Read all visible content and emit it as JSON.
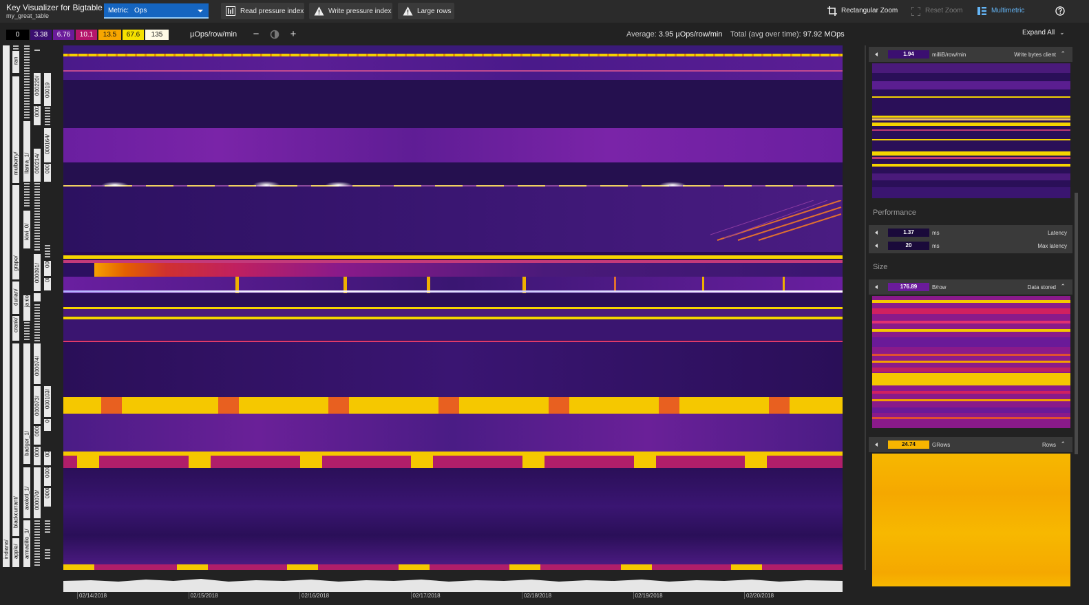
{
  "app": {
    "title": "Key Visualizer for Bigtable",
    "subtitle": "my_great_table"
  },
  "metric": {
    "label": "Metric:",
    "value": "Ops"
  },
  "toolbar": {
    "read_pressure": "Read pressure index",
    "write_pressure": "Write pressure index",
    "large_rows": "Large rows",
    "rect_zoom": "Rectangular Zoom",
    "reset_zoom": "Reset Zoom",
    "multimetric": "Multimetric"
  },
  "scale": {
    "stops": [
      {
        "label": "0",
        "color": "#000000",
        "text": "#ffffff"
      },
      {
        "label": "3.38",
        "color": "#3b0f70",
        "text": "#ffffff"
      },
      {
        "label": "6.76",
        "color": "#6a1b9a",
        "text": "#ffffff"
      },
      {
        "label": "10.1",
        "color": "#b5166b",
        "text": "#ffffff"
      },
      {
        "label": "13.5",
        "color": "#f7a600",
        "text": "#111111"
      },
      {
        "label": "67.6",
        "color": "#f5e000",
        "text": "#111111"
      },
      {
        "label": "135",
        "color": "#fffbe6",
        "text": "#111111"
      }
    ],
    "unit": "µOps/row/min"
  },
  "summary": {
    "average_label": "Average:",
    "average_value": "3.95 µOps/row/min",
    "total_label": "Total (avg over time):",
    "total_value": "97.92 MOps"
  },
  "expand_all": "Expand All",
  "key_labels": {
    "col1": [
      "indiana/",
      "ran"
    ],
    "col2": [
      "apple/",
      "blackcurrant/",
      "crank/",
      "durian/",
      "grape/",
      "mulberry/"
    ],
    "col3": [
      "armadillo_1/",
      "axolotl_1/",
      "badger_1/",
      "jackalope_1/",
      "kiwi_0/",
      "llama_1/",
      "ja"
    ],
    "col4": [
      "000070/",
      "0000",
      "0000",
      "000073/",
      "000074/",
      "000091/",
      "0",
      "000214/",
      "0002",
      "000220/"
    ],
    "col5": [
      "0000",
      "0000",
      "000",
      "000103/",
      "000",
      "000",
      "000",
      "000164/",
      "0001",
      "00019"
    ]
  },
  "xaxis": {
    "ticks": [
      "02/14/2018",
      "02/15/2018",
      "02/16/2018",
      "02/17/2018",
      "02/18/2018",
      "02/19/2018",
      "02/20/2018"
    ]
  },
  "right_panel": {
    "write_bytes": {
      "value": "1.94",
      "unit": "milliB/row/min",
      "name": "Write bytes client",
      "color": "#3b0f70"
    },
    "performance_title": "Performance",
    "latency": {
      "value": "1.37",
      "unit": "ms",
      "name": "Latency",
      "color": "#1a0a3a"
    },
    "max_latency": {
      "value": "20",
      "unit": "ms",
      "name": "Max latency",
      "color": "#1a0a3a"
    },
    "size_title": "Size",
    "data_stored": {
      "value": "176.89",
      "unit": "B/row",
      "name": "Data stored",
      "color": "#6a1b9a"
    },
    "rows": {
      "value": "24.74",
      "unit": "GRows",
      "name": "Rows",
      "color": "#f7b500"
    }
  }
}
